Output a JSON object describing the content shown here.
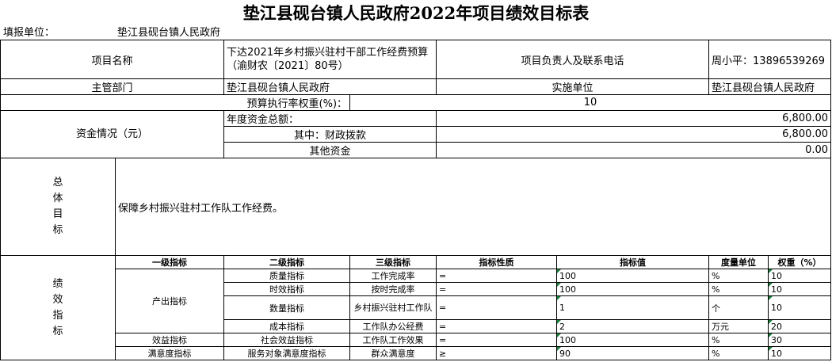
{
  "title": "垫江县砚台镇人民政府2022年项目绩效目标表",
  "filler": {
    "label": "填报单位：",
    "value": "垫江县砚台镇人民政府"
  },
  "project": {
    "name_label": "项目名称",
    "name_value": "下达2021年乡村振兴驻村干部工作经费预算（渝财农〔2021〕80号）",
    "contact_label": "项目负责人及联系电话",
    "contact_value": "周小平：13896539269"
  },
  "dept": {
    "label": "主管部门",
    "value": "垫江县砚台镇人民政府",
    "impl_label": "实施单位",
    "impl_value": "垫江县砚台镇人民政府"
  },
  "budget": {
    "label": "预算执行率权重(%)：",
    "value": "10"
  },
  "funds": {
    "label": "资金情况（元）",
    "total_label": "年度资金总额：",
    "total_value": "6,800.00",
    "fiscal_label": "其中：财政拨款",
    "fiscal_value": "6,800.00",
    "other_label": "其他资金",
    "other_value": "0.00"
  },
  "goal": {
    "label": "总体目标",
    "value": "保障乡村振兴驻村工作队工作经费。"
  },
  "perf": {
    "label": "绩效指标",
    "headers": [
      "一级指标",
      "二级指标",
      "三级指标",
      "指标性质",
      "指标值",
      "度量单位",
      "权重（%）"
    ],
    "rows": [
      {
        "l1": "产出指标",
        "l2": "质量指标",
        "l3": "工作完成率",
        "nature": "=",
        "value": "100",
        "unit": "%",
        "weight": "10"
      },
      {
        "l1": "",
        "l2": "时效指标",
        "l3": "按时完成率",
        "nature": "=",
        "value": "100",
        "unit": "%",
        "weight": "10"
      },
      {
        "l1": "",
        "l2": "数量指标",
        "l3": "乡村振兴驻村工作队",
        "nature": "=",
        "value": "1",
        "unit": "个",
        "weight": "10"
      },
      {
        "l1": "",
        "l2": "成本指标",
        "l3": "工作队办公经费",
        "nature": "=",
        "value": "2",
        "unit": "万元",
        "weight": "20"
      },
      {
        "l1": "效益指标",
        "l2": "社会效益指标",
        "l3": "工作队工作效果",
        "nature": "=",
        "value": "100",
        "unit": "%",
        "weight": "30"
      },
      {
        "l1": "满意度指标",
        "l2": "服务对象满意度指标",
        "l3": "群众满意度",
        "nature": "≥",
        "value": "90",
        "unit": "%",
        "weight": "10"
      }
    ]
  }
}
